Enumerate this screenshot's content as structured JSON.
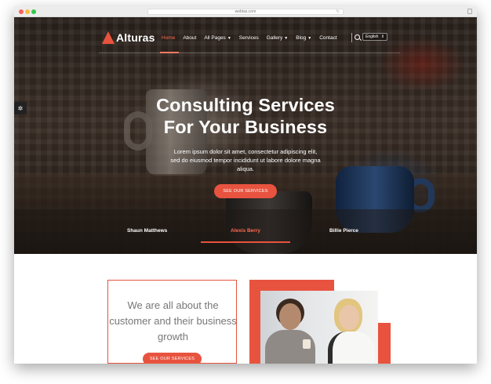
{
  "browser": {
    "url": "webtas.com"
  },
  "header": {
    "logo_text": "Alturas",
    "menu": [
      {
        "label": "Home",
        "active": true,
        "dropdown": false
      },
      {
        "label": "About",
        "active": false,
        "dropdown": false
      },
      {
        "label": "All Pages",
        "active": false,
        "dropdown": true
      },
      {
        "label": "Services",
        "active": false,
        "dropdown": false
      },
      {
        "label": "Gallery",
        "active": false,
        "dropdown": true
      },
      {
        "label": "Blog",
        "active": false,
        "dropdown": true
      },
      {
        "label": "Contact",
        "active": false,
        "dropdown": false
      }
    ],
    "language": "English",
    "search_icon": "search-icon"
  },
  "hero": {
    "title_line1": "Consulting Services",
    "title_line2": "For Your Business",
    "text": "Lorem ipsum dolor sit amet, consectetur adipiscing elit, sed do eiusmod tempor incididunt ut labore dolore magna aliqua.",
    "button": "SEE OUR SERVICES",
    "testimonials": [
      {
        "name": "Shaun Matthews",
        "active": false
      },
      {
        "name": "Alexis Berry",
        "active": true
      },
      {
        "name": "Billie Pierce",
        "active": false
      }
    ]
  },
  "about": {
    "text": "We are all about the customer and their business growth",
    "button": "SEE OUR SERVICES"
  },
  "colors": {
    "accent": "#e8533f",
    "active_link": "#ff6a4f"
  }
}
